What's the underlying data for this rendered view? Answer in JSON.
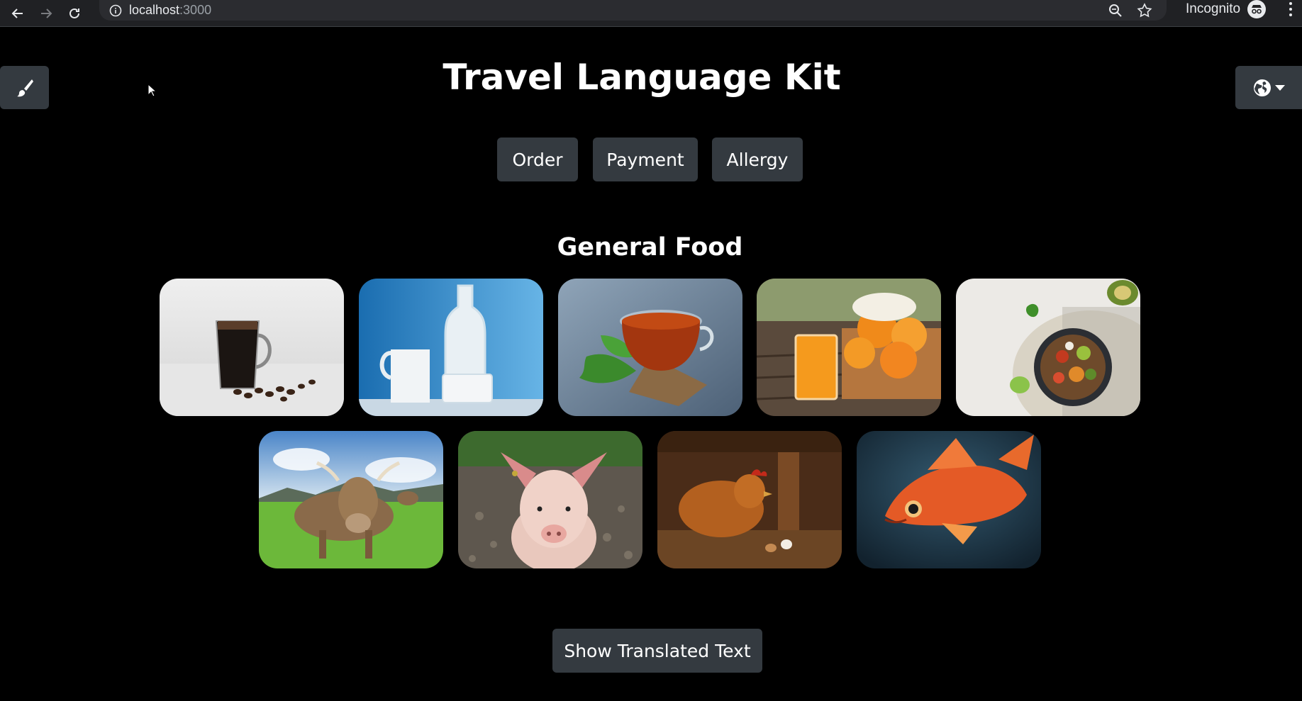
{
  "browser": {
    "host": "localhost",
    "port": ":3000",
    "mode_label": "Incognito"
  },
  "app": {
    "title": "Travel Language Kit",
    "categories": [
      {
        "label": "Order"
      },
      {
        "label": "Payment"
      },
      {
        "label": "Allergy"
      }
    ],
    "section_title": "General Food",
    "foods": [
      {
        "icon": "coffee-image"
      },
      {
        "icon": "milk-image"
      },
      {
        "icon": "tea-image"
      },
      {
        "icon": "orange-juice-image"
      },
      {
        "icon": "salad-image"
      },
      {
        "icon": "cow-image"
      },
      {
        "icon": "pig-image"
      },
      {
        "icon": "chicken-image"
      },
      {
        "icon": "fish-image"
      }
    ],
    "show_translated_label": "Show Translated Text"
  },
  "colors": {
    "background": "#000000",
    "button": "#343a40",
    "chrome": "#202124"
  }
}
